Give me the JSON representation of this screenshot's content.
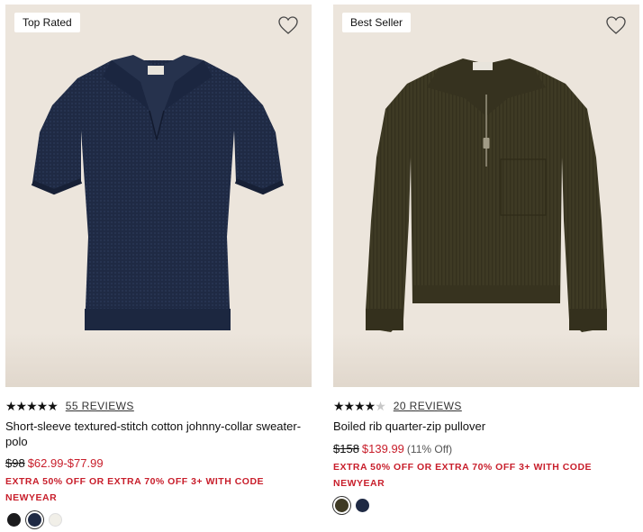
{
  "products": [
    {
      "badge": "Top Rated",
      "rating": {
        "stars": 5,
        "reviews_label": "55 REVIEWS"
      },
      "name": "Short-sleeve textured-stitch cotton johnny-collar sweater-polo",
      "price": {
        "original": "$98",
        "sale": "$62.99-$77.99"
      },
      "promo": "EXTRA 50% OFF OR EXTRA 70% OFF 3+ WITH CODE NEWYEAR",
      "swatches": [
        {
          "color": "#1b1b1d",
          "selected": false
        },
        {
          "color": "#1f2a44",
          "selected": true
        },
        {
          "color": "#f1efe8",
          "selected": false
        }
      ],
      "icons": {
        "favorite": "heart-outline-icon"
      }
    },
    {
      "badge": "Best Seller",
      "rating": {
        "stars": 4.5,
        "reviews_label": "20 REVIEWS"
      },
      "name": "Boiled rib quarter-zip pullover",
      "price": {
        "original": "$158",
        "sale": "$139.99",
        "discount": "(11% Off)"
      },
      "promo": "EXTRA 50% OFF OR EXTRA 70% OFF 3+ WITH CODE NEWYEAR",
      "swatches": [
        {
          "color": "#3e3a24",
          "selected": true
        },
        {
          "color": "#1f2a44",
          "selected": false
        }
      ],
      "icons": {
        "favorite": "heart-outline-icon"
      }
    }
  ],
  "colors": {
    "sale_red": "#c81e2b",
    "image_bg": "#ece5dc"
  }
}
